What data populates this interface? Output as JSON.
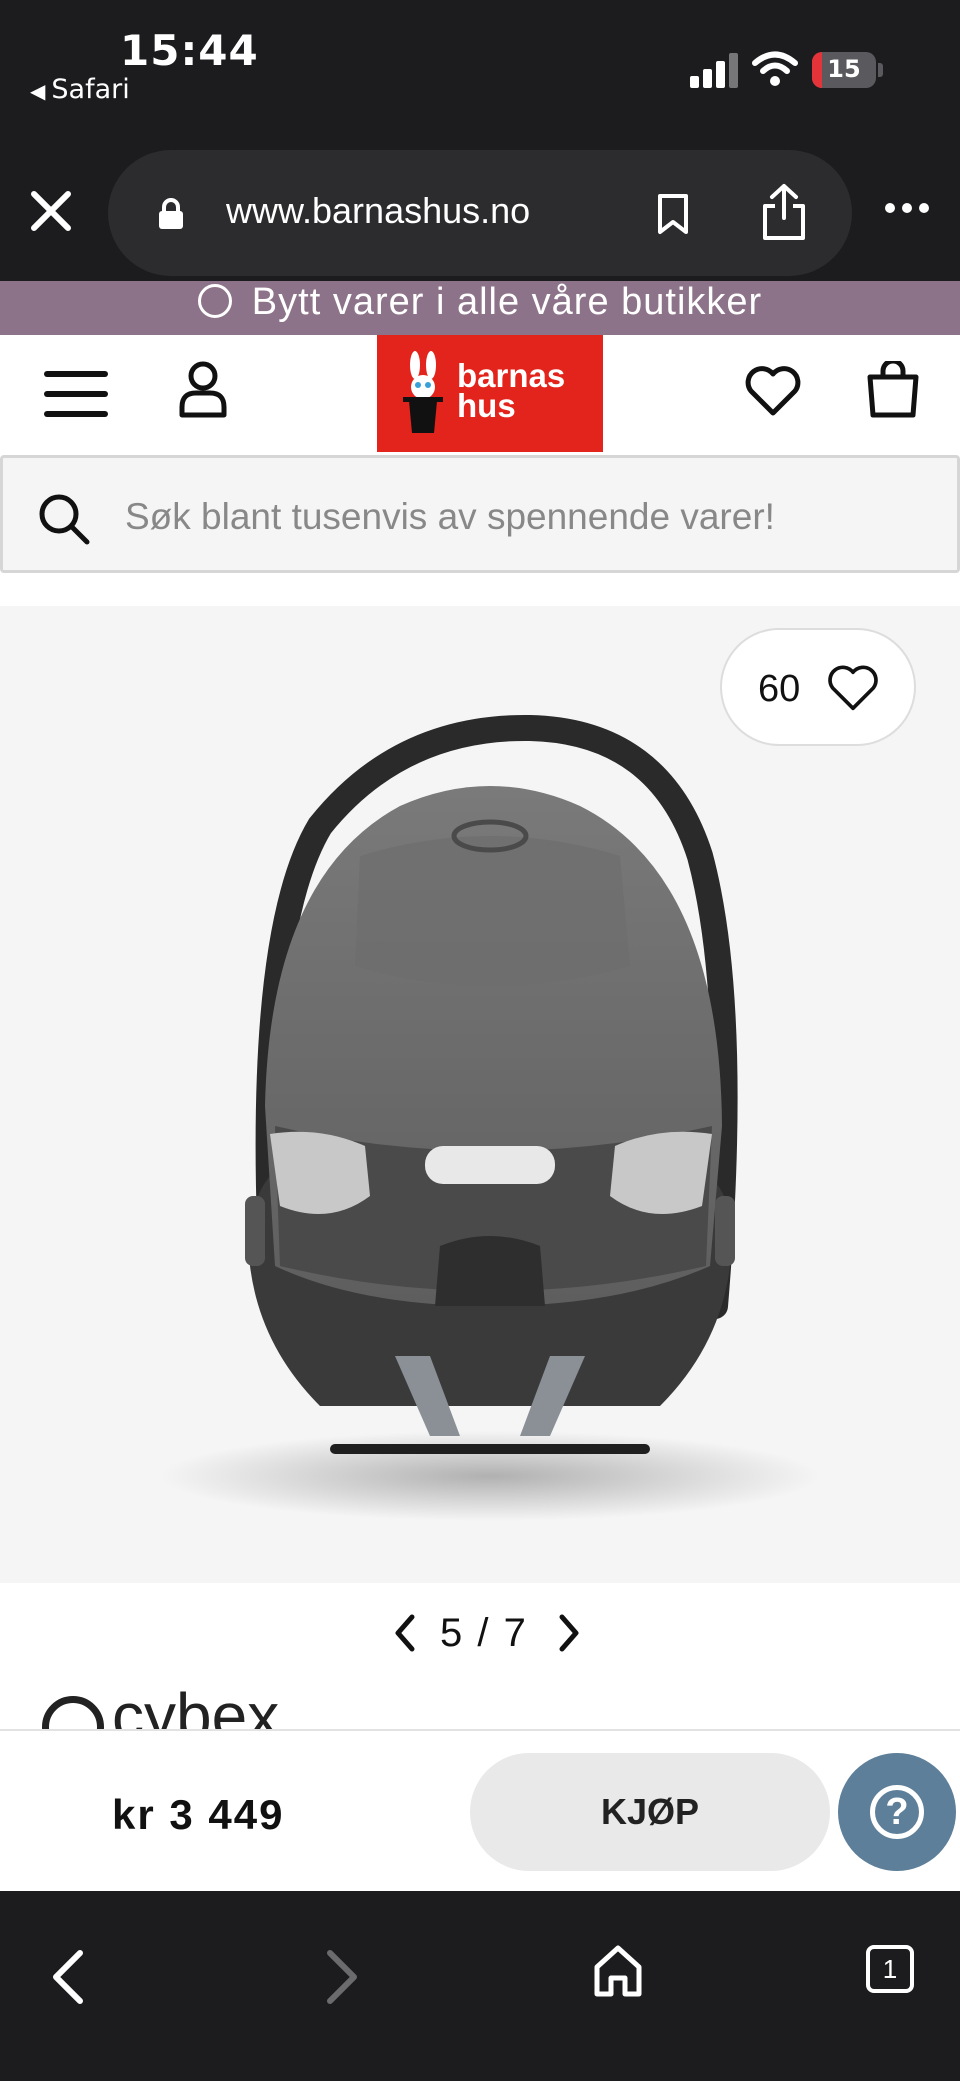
{
  "status_bar": {
    "time": "15:44",
    "back_app": "Safari",
    "battery": "15",
    "battery_level": 0.15
  },
  "browser": {
    "url": "www.barnashus.no"
  },
  "site": {
    "banner": "Bytt varer i alle våre butikker",
    "logo_line1": "barnas",
    "logo_line2": "hus",
    "search_placeholder": "Søk blant tusenvis av spennende varer!"
  },
  "product": {
    "favorites_count": "60",
    "image_index": "5",
    "image_total": "7",
    "pager_sep": "/",
    "brand": "cybex",
    "price": "kr 3 449",
    "buy_label": "KJØP"
  },
  "toolbar": {
    "tabs_count": "1"
  },
  "colors": {
    "chrome": "#1c1c1e",
    "banner": "#8d7389",
    "logo": "#e2241c",
    "help": "#5d7f99",
    "battery_low": "#e5333a"
  }
}
